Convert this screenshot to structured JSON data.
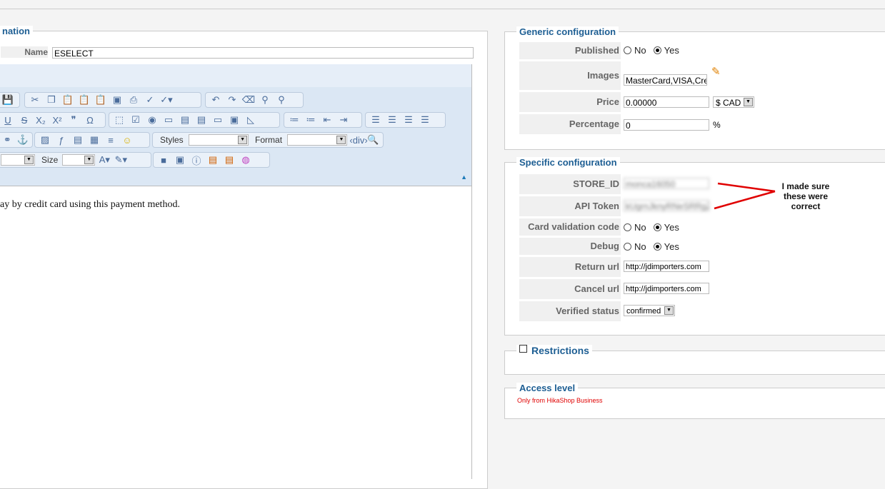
{
  "left": {
    "legend": "nation",
    "name_label": "Name",
    "name_value": "ESELECT",
    "editor": {
      "styles_label": "Styles",
      "format_label": "Format",
      "size_label": "Size",
      "content": "ay by credit card using this payment method."
    }
  },
  "generic": {
    "legend": "Generic configuration",
    "published_label": "Published",
    "no": "No",
    "yes": "Yes",
    "images_label": "Images",
    "images_value": "MasterCard,VISA,Credit_",
    "price_label": "Price",
    "price_value": "0.00000",
    "currency": "$ CAD",
    "percentage_label": "Percentage",
    "percentage_value": "0",
    "percent_sign": "%"
  },
  "specific": {
    "legend": "Specific configuration",
    "store_id_label": "STORE_ID",
    "store_id_value": "monca16050",
    "api_token_label": "API Token",
    "api_token_value": "kUgrnJknyRNeSRRgZ",
    "cvc_label": "Card validation code",
    "debug_label": "Debug",
    "no": "No",
    "yes": "Yes",
    "return_label": "Return url",
    "return_value": "http://jdimporters.com",
    "cancel_label": "Cancel url",
    "cancel_value": "http://jdimporters.com",
    "verified_label": "Verified status",
    "verified_value": "confirmed"
  },
  "annotation": {
    "text": "I made sure these were correct",
    "color": "#e00000"
  },
  "restrictions": {
    "legend": "Restrictions"
  },
  "access": {
    "legend": "Access level",
    "note": "Only from HikaShop Business"
  }
}
